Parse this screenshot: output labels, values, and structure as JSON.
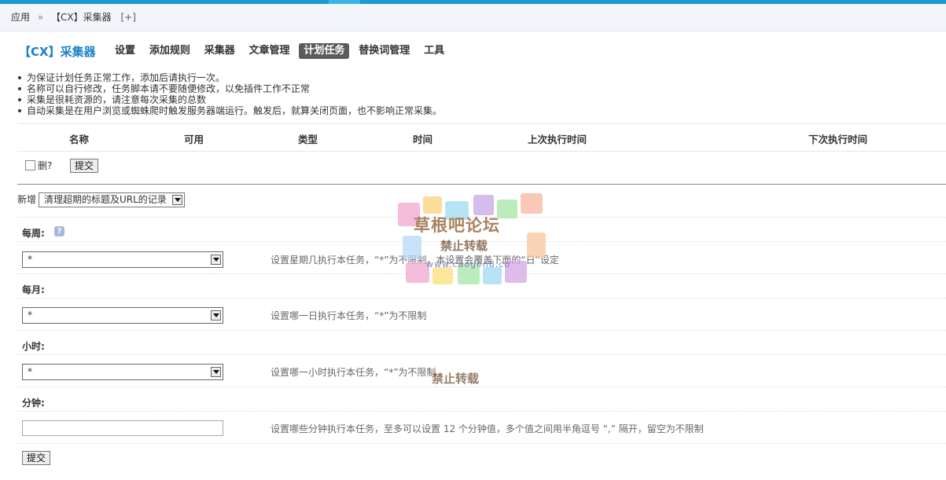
{
  "breadcrumb": {
    "home": "应用",
    "sep": "»",
    "current": "【CX】采集器",
    "plus": "[+]"
  },
  "plugin_title": "【CX】采集器",
  "nav": [
    {
      "label": "设置"
    },
    {
      "label": "添加规则"
    },
    {
      "label": "采集器"
    },
    {
      "label": "文章管理"
    },
    {
      "label": "计划任务",
      "active": true
    },
    {
      "label": "替换词管理"
    },
    {
      "label": "工具"
    }
  ],
  "tips": [
    "为保证计划任务正常工作，添加后请执行一次。",
    "名称可以自行修改，任务脚本请不要随便修改，以免插件工作不正常",
    "采集是很耗资源的，请注意每次采集的总数",
    "自动采集是在用户浏览或蜘蛛爬时触发服务器端运行。触发后，就算关闭页面，也不影响正常采集。"
  ],
  "table_headers": [
    "名称",
    "可用",
    "类型",
    "时间",
    "上次执行时间",
    "下次执行时间"
  ],
  "delete_label": "删?",
  "submit_label": "提交",
  "add": {
    "label": "新增",
    "selected": "清理超期的标题及URL的记录"
  },
  "fields": [
    {
      "label": "每周:",
      "value": "*",
      "desc": "设置星期几执行本任务，“*”为不限制，本设置会覆盖下面的“日”设定"
    },
    {
      "label": "每月:",
      "value": "*",
      "desc": "设置哪一日执行本任务，“*”为不限制"
    },
    {
      "label": "小时:",
      "value": "*",
      "desc": "设置哪一小时执行本任务，“*”为不限制"
    },
    {
      "label": "分钟:",
      "value": "",
      "desc": "设置哪些分钟执行本任务，至多可以设置 12 个分钟值，多个值之间用半角逗号 “,” 隔开，留空为不限制"
    }
  ],
  "help_icon": "question-icon",
  "watermark": {
    "title": "草根吧论坛",
    "sub": "禁止转载",
    "url": "www.caogen8.co"
  },
  "colors": {
    "accent": "#1b9bd3",
    "title": "#1a82c4",
    "active_tab": "#5b5b5b"
  }
}
